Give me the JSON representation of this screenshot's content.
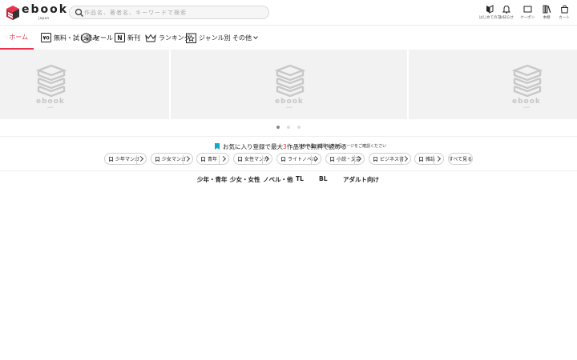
{
  "header": {
    "logo": {
      "word": "ebook",
      "sub": "japan"
    },
    "search": {
      "placeholder": "作品名、著者名、キーワードで検索"
    },
    "icons": [
      {
        "name": "beginner-icon",
        "label": "はじめての方"
      },
      {
        "name": "bell-icon",
        "label": "お知らせ"
      },
      {
        "name": "coupon-icon",
        "label": "クーポン"
      },
      {
        "name": "bookshelf-icon",
        "label": "本棚"
      },
      {
        "name": "cart-icon",
        "label": "カート"
      }
    ]
  },
  "nav": {
    "items": [
      {
        "label": "ホーム",
        "active": true
      },
      {
        "label": "無料・試し読み"
      },
      {
        "label": "セール"
      },
      {
        "label": "新刊"
      },
      {
        "label": "ランキング"
      },
      {
        "label": "ジャンル別"
      }
    ],
    "more": "その他"
  },
  "banner": {
    "placeholder_word": "ebook",
    "placeholder_sub": "japan",
    "dots": [
      true,
      false,
      false
    ]
  },
  "promo": {
    "text_before": "お気に入り登録で最大",
    "highlight": "3",
    "text_after": "作品まで無料で読める",
    "note": "※対象作品・期間は各作品ページをご確認ください"
  },
  "tags": [
    {
      "label": "少年マンガ",
      "bookmark": true
    },
    {
      "label": "少女マンガ",
      "bookmark": true
    },
    {
      "label": "青年",
      "bookmark": true
    },
    {
      "label": "女性マンガ",
      "bookmark": true
    },
    {
      "label": "ライトノベル",
      "bookmark": true
    },
    {
      "label": "小説・文芸",
      "bookmark": true
    },
    {
      "label": "ビジネス書",
      "bookmark": true
    },
    {
      "label": "雑誌",
      "bookmark": true
    },
    {
      "label": "すべて見る",
      "bookmark": false
    }
  ],
  "categories": [
    "少年・青年",
    "少女・女性",
    "ノベル・他",
    "TL",
    "BL",
    "アダルト向け"
  ],
  "colors": {
    "accent": "#e8344e",
    "teal": "#14a9c6",
    "logo_red": "#e8344e",
    "logo_dark": "#333333"
  }
}
